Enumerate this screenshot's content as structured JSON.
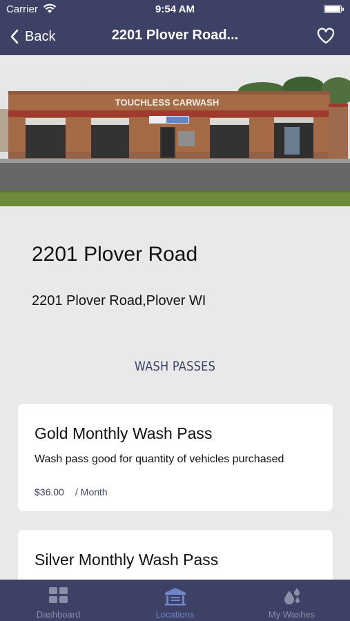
{
  "status": {
    "carrier": "Carrier",
    "time": "9:54 AM"
  },
  "nav": {
    "back_label": "Back",
    "title": "2201 Plover Road..."
  },
  "hero": {
    "sign_text": "TOUCHLESS CARWASH"
  },
  "location": {
    "title": "2201 Plover Road",
    "address": "2201 Plover Road,Plover WI"
  },
  "section_title": "WASH PASSES",
  "passes": [
    {
      "name": "Gold Monthly Wash Pass",
      "description": "Wash pass good for quantity of vehicles purchased",
      "price": "$36.00",
      "period": "/ Month"
    },
    {
      "name": "Silver Monthly Wash Pass"
    }
  ],
  "tabs": [
    {
      "label": "Dashboard",
      "icon": "grid-icon"
    },
    {
      "label": "Locations",
      "icon": "building-icon"
    },
    {
      "label": "My Washes",
      "icon": "droplets-icon"
    }
  ],
  "colors": {
    "primary": "#3c4165",
    "tab_active": "#6f84c9",
    "background": "#e9e9ea"
  }
}
